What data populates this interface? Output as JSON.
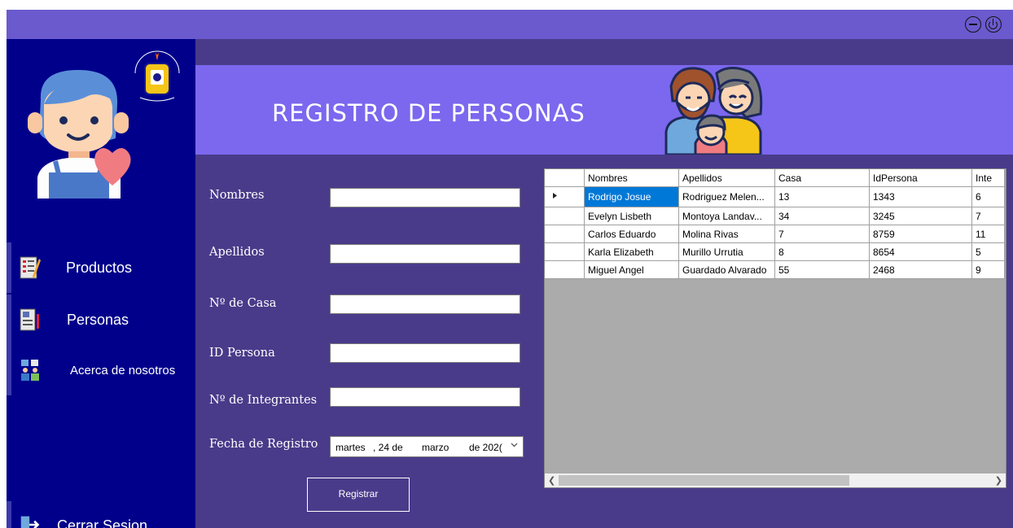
{
  "sidebar": {
    "items": [
      {
        "label": "Productos",
        "icon": "checklist-icon"
      },
      {
        "label": "Personas",
        "icon": "id-card-icon"
      },
      {
        "label": "Acerca de nosotros",
        "icon": "team-icon"
      }
    ],
    "logout_label": "Cerrar Sesion"
  },
  "header": {
    "title": "REGISTRO DE PERSONAS"
  },
  "form": {
    "labels": {
      "nombres": "Nombres",
      "apellidos": "Apellidos",
      "casa": "Nº de Casa",
      "id": "ID Persona",
      "integrantes": "Nº de Integrantes",
      "fecha": "Fecha de Registro"
    },
    "values": {
      "nombres": "",
      "apellidos": "",
      "casa": "",
      "id": "",
      "integrantes": ""
    },
    "date": {
      "weekday": "martes",
      "day": ", 24 de",
      "month": "marzo",
      "year": "de 202("
    },
    "submit_label": "Registrar"
  },
  "table": {
    "columns": [
      "Nombres",
      "Apellidos",
      "Casa",
      "IdPersona",
      "Inte"
    ],
    "rows": [
      [
        "Rodrigo Josue",
        "Rodriguez Melen...",
        "13",
        "1343",
        "6"
      ],
      [
        "Evelyn Lisbeth",
        "Montoya Landav...",
        "34",
        "3245",
        "7"
      ],
      [
        "Carlos Eduardo",
        "Molina Rivas",
        "7",
        "8759",
        "11"
      ],
      [
        "Karla Elizabeth",
        "Murillo Urrutia",
        "8",
        "8654",
        "5"
      ],
      [
        "Miguel Angel",
        "Guardado Alvarado",
        "55",
        "2468",
        "9"
      ]
    ]
  },
  "colors": {
    "titlebar": "#6a5acd",
    "sidebar": "#00008b",
    "header": "#7b68ee",
    "body": "#4a3b8a",
    "selection": "#0078d7"
  }
}
